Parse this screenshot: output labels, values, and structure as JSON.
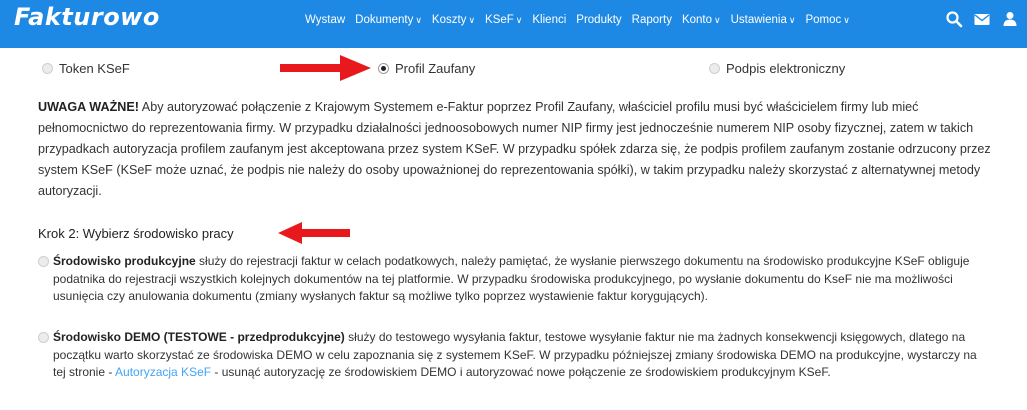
{
  "navbar": {
    "brand": "Fakturowo",
    "menu": [
      {
        "label": "Wystaw",
        "dropdown": false
      },
      {
        "label": "Dokumenty",
        "dropdown": true
      },
      {
        "label": "Koszty",
        "dropdown": true
      },
      {
        "label": "KSeF",
        "dropdown": true
      },
      {
        "label": "Klienci",
        "dropdown": false
      },
      {
        "label": "Produkty",
        "dropdown": false
      },
      {
        "label": "Raporty",
        "dropdown": false
      },
      {
        "label": "Konto",
        "dropdown": true
      },
      {
        "label": "Ustawienia",
        "dropdown": true
      },
      {
        "label": "Pomoc",
        "dropdown": true
      }
    ],
    "icons": [
      "search-icon",
      "mail-icon",
      "user-icon"
    ],
    "color": "#1e88e5"
  },
  "auth_methods": {
    "options": [
      "Token KSeF",
      "Profil Zaufany",
      "Podpis elektroniczny"
    ],
    "selected": "Profil Zaufany"
  },
  "warning": {
    "lead": "UWAGA WAŻNE!",
    "text": " Aby autoryzować połączenie z Krajowym Systemem e-Faktur poprzez Profil Zaufany, właściciel profilu musi być właścicielem firmy lub mieć pełnomocnictwo do reprezentowania firmy. W przypadku działalności jednoosobowych numer NIP firmy jest jednocześnie numerem NIP osoby fizycznej, zatem w takich przypadkach autoryzacja profilem zaufanym jest akceptowana przez system KSeF. W przypadku spółek zdarza się, że podpis profilem zaufanym zostanie odrzucony przez system KSeF (KSeF może uznać, że podpis nie należy do osoby upoważnionej do reprezentowania spółki), w takim przypadku należy skorzystać z alternatywnej metody autoryzacji."
  },
  "step2": {
    "heading": "Krok 2: Wybierz środowisko pracy",
    "production": {
      "lead": "Środowisko produkcyjne",
      "text": " służy do rejestracji faktur w celach podatkowych, należy pamiętać, że wysłanie pierwszego dokumentu na środowisko produkcyjne KSeF obliguje podatnika do rejestracji wszystkich kolejnych dokumentów na tej platformie. W przypadku środowiska produkcyjnego, po wysłanie dokumentu do KseF nie ma możliwości usunięcia czy anulowania dokumentu (zmiany wysłanych faktur są możliwe tylko poprzez wystawienie faktur korygujących)."
    },
    "demo": {
      "lead": "Środowisko DEMO (TESTOWE - przedprodukcyjne)",
      "text_before": " służy do testowego wysyłania faktur, testowe wysyłanie faktur nie ma żadnych konsekwencji księgowych, dlatego na początku warto skorzystać ze środowiska DEMO w celu zapoznania się z systemem KSeF. W przypadku późniejszej zmiany środowiska DEMO na produkcyjne, wystarczy na tej stronie - ",
      "link": "Autoryzacja KSeF",
      "text_after": " - usunąć autoryzację ze środowiskiem DEMO i autoryzować nowe połączenie ze środowiskiem produkcyjnym KSeF."
    }
  },
  "colors": {
    "arrow": "#e8191c",
    "link": "#42a5f5"
  }
}
